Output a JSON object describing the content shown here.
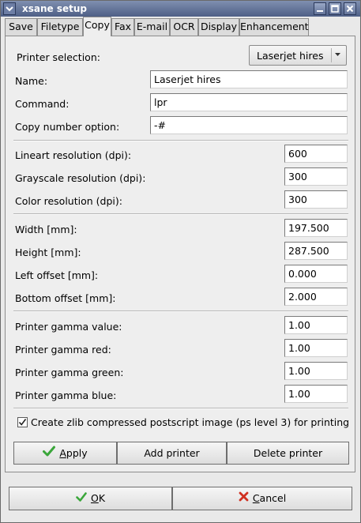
{
  "window": {
    "title": "xsane setup"
  },
  "tabs": [
    "Save",
    "Filetype",
    "Copy",
    "Fax",
    "E-mail",
    "OCR",
    "Display",
    "Enhancement"
  ],
  "active_tab": "Copy",
  "printer_selection": {
    "label": "Printer selection:",
    "value": "Laserjet hires"
  },
  "printer": {
    "name": {
      "label": "Name:",
      "value": "Laserjet hires"
    },
    "command": {
      "label": "Command:",
      "value": "lpr"
    },
    "copy_number_option": {
      "label": "Copy number option:",
      "value": "-#"
    }
  },
  "resolution": {
    "lineart": {
      "label": "Lineart resolution (dpi):",
      "value": "600"
    },
    "grayscale": {
      "label": "Grayscale resolution (dpi):",
      "value": "300"
    },
    "color": {
      "label": "Color resolution (dpi):",
      "value": "300"
    }
  },
  "geometry": {
    "width": {
      "label": "Width [mm]:",
      "value": "197.500"
    },
    "height": {
      "label": "Height [mm]:",
      "value": "287.500"
    },
    "left_offset": {
      "label": "Left offset [mm]:",
      "value": "0.000"
    },
    "bottom_offset": {
      "label": "Bottom offset [mm]:",
      "value": "2.000"
    }
  },
  "gamma": {
    "value": {
      "label": "Printer gamma value:",
      "value": "1.00"
    },
    "red": {
      "label": "Printer gamma red:",
      "value": "1.00"
    },
    "green": {
      "label": "Printer gamma green:",
      "value": "1.00"
    },
    "blue": {
      "label": "Printer gamma blue:",
      "value": "1.00"
    }
  },
  "zlib_checkbox": {
    "label": "Create zlib compressed postscript image (ps level 3) for printing",
    "checked": true
  },
  "printer_buttons": {
    "apply_first": "A",
    "apply_rest": "pply",
    "add": "Add printer",
    "delete": "Delete printer"
  },
  "dialog_buttons": {
    "ok_first": "O",
    "ok_rest": "K",
    "cancel_first": "C",
    "cancel_rest": "ancel"
  },
  "colors": {
    "titlebar": "#5a6b94",
    "ok_check": "#3aa63a",
    "cancel_x": "#d03020"
  }
}
